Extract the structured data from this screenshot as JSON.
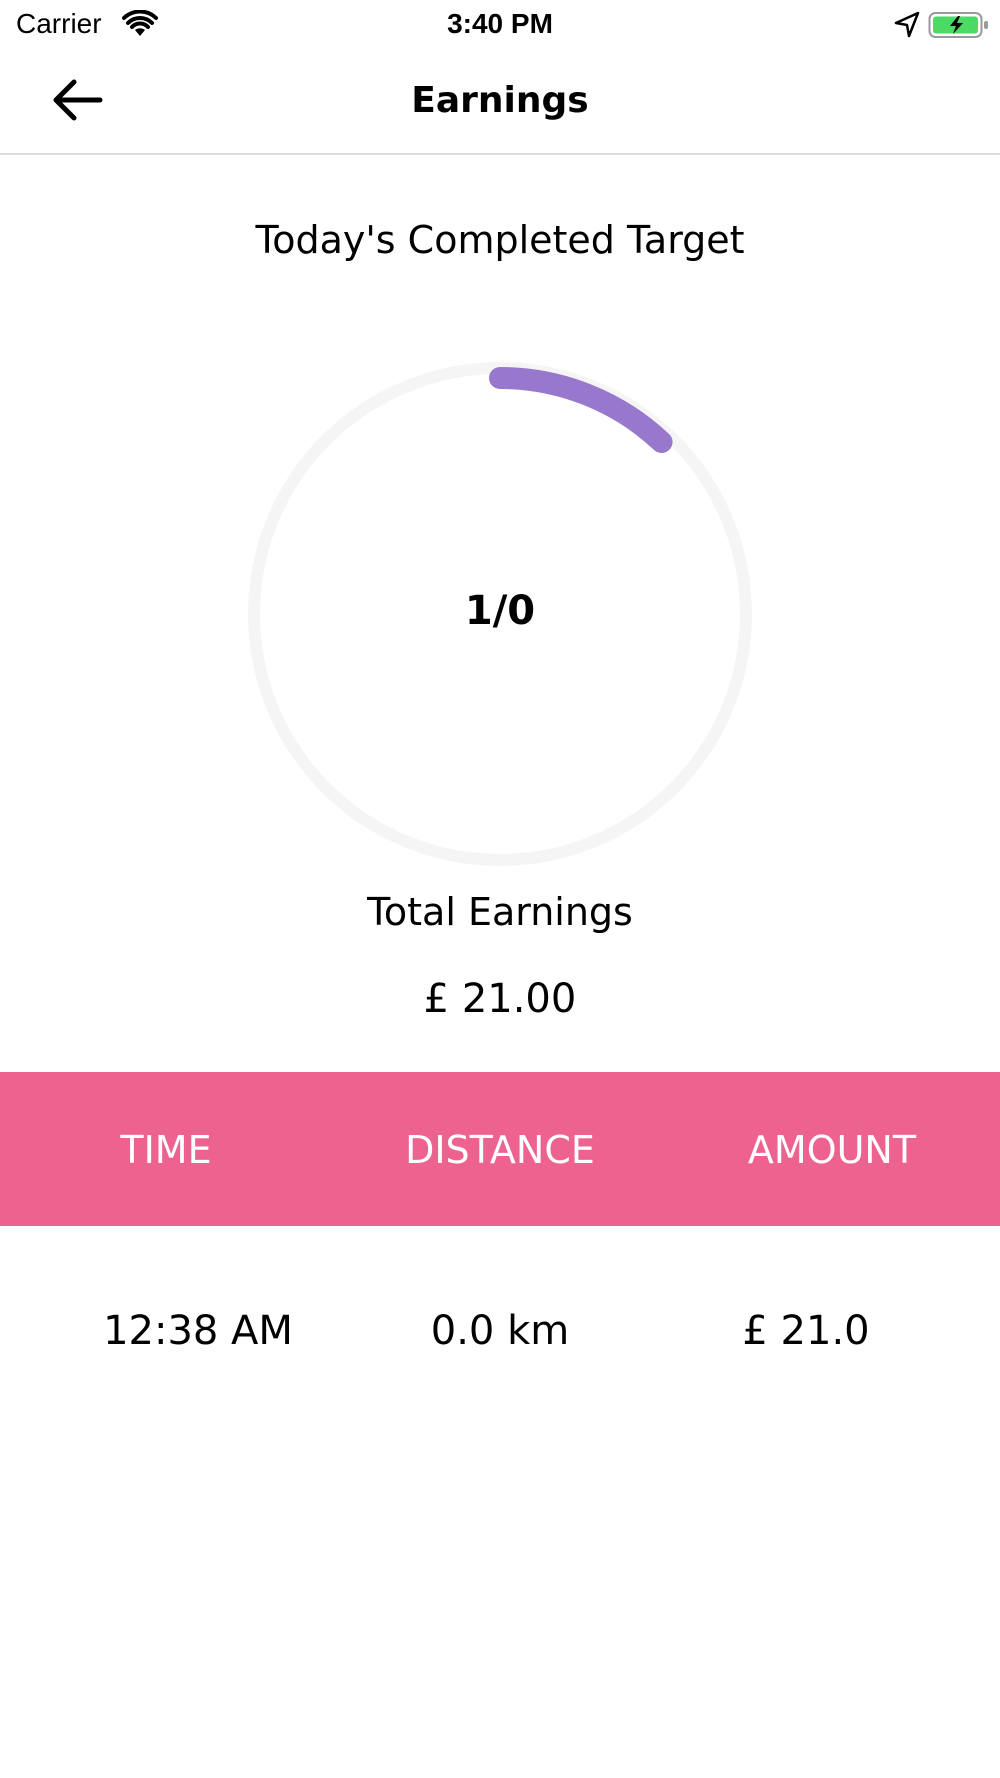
{
  "status_bar": {
    "carrier": "Carrier",
    "time": "3:40 PM",
    "icons": [
      "wifi-icon",
      "location-arrow-icon",
      "battery-charging-icon"
    ]
  },
  "nav": {
    "title": "Earnings",
    "back_icon": "arrow-left-icon"
  },
  "target": {
    "title": "Today's Completed Target",
    "value": "1/0",
    "progress_fraction": 0.12
  },
  "earnings": {
    "label": "Total Earnings",
    "value": "£ 21.00"
  },
  "table": {
    "headers": [
      "TIME",
      "DISTANCE",
      "AMOUNT"
    ],
    "rows": [
      {
        "time": "12:38 AM",
        "distance": "0.0 km",
        "amount": "£ 21.0"
      }
    ]
  },
  "colors": {
    "accent_pink": "#EE6290",
    "progress_purple": "#9878CD",
    "ring_track": "#F5F5F5",
    "divider": "#DCDCDC"
  }
}
